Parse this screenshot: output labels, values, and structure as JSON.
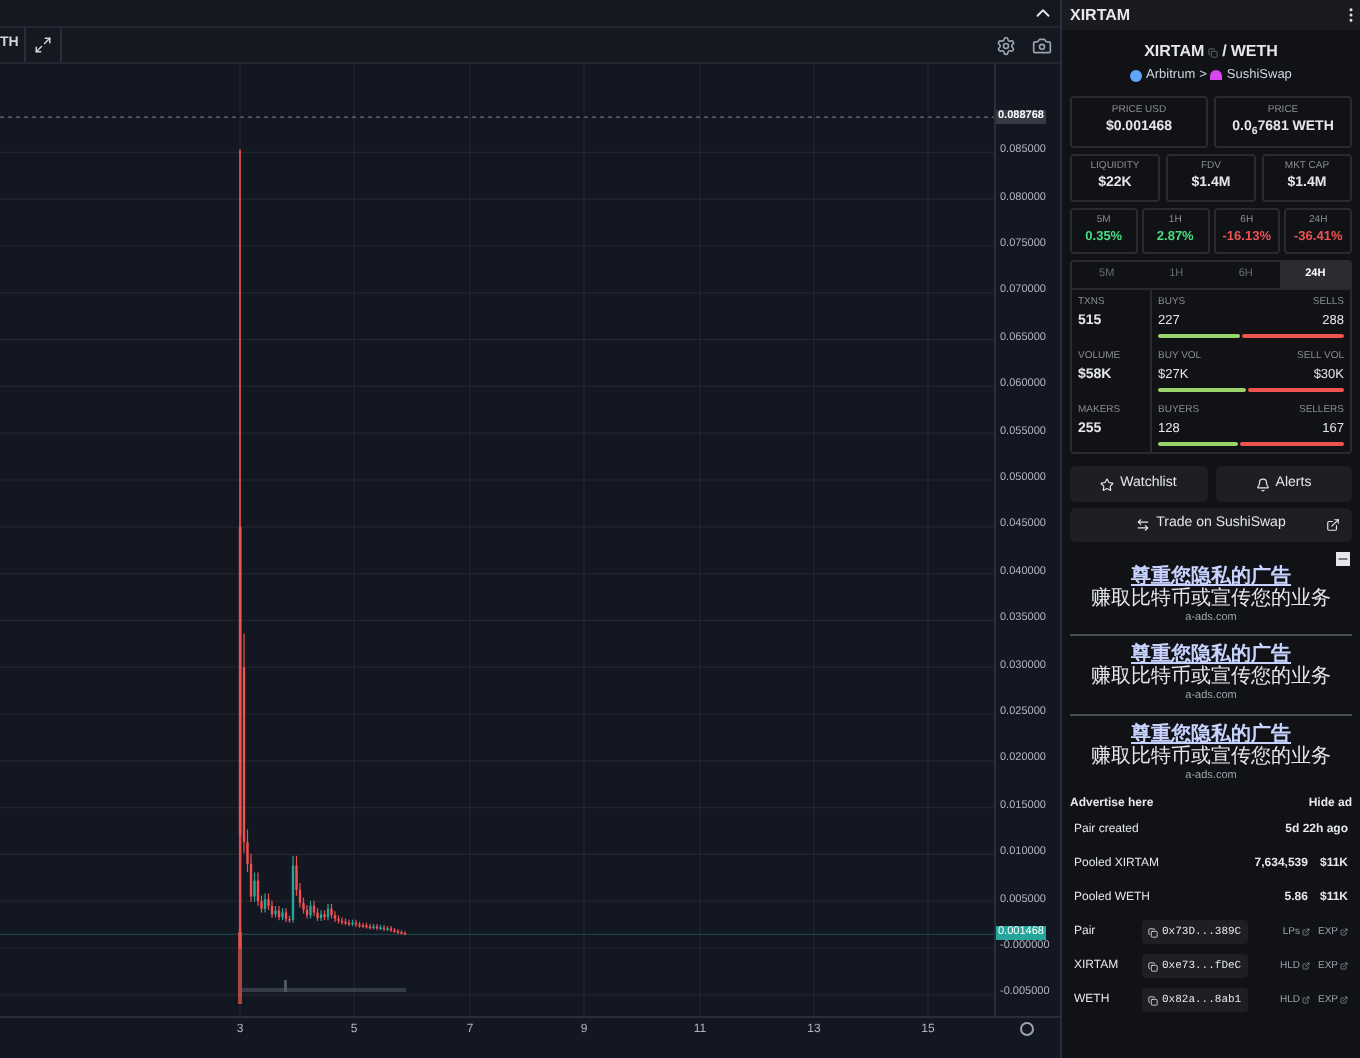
{
  "toolbar": {
    "symbol_fragment": "TH"
  },
  "chart": {
    "high_label": "0.088768",
    "price_label": "0.001468",
    "y_axis_labels": [
      "0.085000",
      "0.080000",
      "0.075000",
      "0.070000",
      "0.065000",
      "0.060000",
      "0.055000",
      "0.050000",
      "0.045000",
      "0.040000",
      "0.035000",
      "0.030000",
      "0.025000",
      "0.020000",
      "0.015000",
      "0.010000",
      "0.005000",
      "-0.000000",
      "-0.005000"
    ],
    "x_axis_labels": [
      "3",
      "5",
      "7",
      "9",
      "11",
      "13",
      "15"
    ]
  },
  "sidebar": {
    "title": "XIRTAM",
    "pair": {
      "base": "XIRTAM",
      "separator": "/",
      "quote": "WETH",
      "chain": "Arbitrum",
      "arrow": ">",
      "dex": "SushiSwap"
    },
    "price_cards": [
      {
        "label": "PRICE USD",
        "value": "$0.001468"
      },
      {
        "label": "PRICE",
        "value": "0.0$_{6}$7681 WETH"
      }
    ],
    "stats": [
      {
        "label": "LIQUIDITY",
        "value": "$22K"
      },
      {
        "label": "FDV",
        "value": "$1.4M"
      },
      {
        "label": "MKT CAP",
        "value": "$1.4M"
      }
    ],
    "changes": [
      {
        "label": "5M",
        "value": "0.35%",
        "color": "#4ade80"
      },
      {
        "label": "1H",
        "value": "2.87%",
        "color": "#4ade80"
      },
      {
        "label": "6H",
        "value": "-16.13%",
        "color": "#f05252"
      },
      {
        "label": "24H",
        "value": "-36.41%",
        "color": "#f05252"
      }
    ],
    "period_tabs": [
      {
        "label": "5M",
        "selected": false
      },
      {
        "label": "1H",
        "selected": false
      },
      {
        "label": "6H",
        "selected": false
      },
      {
        "label": "24H",
        "selected": true
      }
    ],
    "activity": [
      {
        "label": "TXNS",
        "value": "515",
        "left_label": "BUYS",
        "left_value": "227",
        "right_label": "SELLS",
        "right_value": "288",
        "level": 0.44
      },
      {
        "label": "VOLUME",
        "value": "$58K",
        "left_label": "BUY VOL",
        "left_value": "$27K",
        "right_label": "SELL VOL",
        "right_value": "$30K",
        "level": 0.47
      },
      {
        "label": "MAKERS",
        "value": "255",
        "left_label": "BUYERS",
        "left_value": "128",
        "right_label": "SELLERS",
        "right_value": "167",
        "level": 0.43
      }
    ],
    "buttons": [
      {
        "label": "Watchlist",
        "kind": "star"
      },
      {
        "label": "Alerts",
        "kind": "bell"
      }
    ],
    "trade_button": "Trade on SushiSwap",
    "ads": [
      {
        "title": "尊重您隐私的广告",
        "text": "赚取比特币或宣传您的业务",
        "domain": "a-ads.com"
      },
      {
        "title": "尊重您隐私的广告",
        "text": "赚取比特币或宣传您的业务",
        "domain": "a-ads.com"
      },
      {
        "title": "尊重您隐私的广告",
        "text": "赚取比特币或宣传您的业务",
        "domain": "a-ads.com"
      }
    ],
    "ad_footer": {
      "advertise": "Advertise here",
      "hide": "Hide ad"
    },
    "info_rows": [
      {
        "label": "Pair created",
        "values": [
          "5d 22h ago"
        ]
      },
      {
        "label": "Pooled XIRTAM",
        "values": [
          "7,634,539",
          "$11K"
        ]
      },
      {
        "label": "Pooled WETH",
        "values": [
          "5.86",
          "$11K"
        ]
      }
    ],
    "address_rows": [
      {
        "label": "Pair",
        "address": "0x73D...389C",
        "links": [
          "LPs",
          "EXP"
        ]
      },
      {
        "label": "XIRTAM",
        "address": "0xe73...fDeC",
        "links": [
          "HLD",
          "EXP"
        ]
      },
      {
        "label": "WETH",
        "address": "0x82a...8ab1",
        "links": [
          "HLD",
          "EXP"
        ]
      }
    ]
  }
}
